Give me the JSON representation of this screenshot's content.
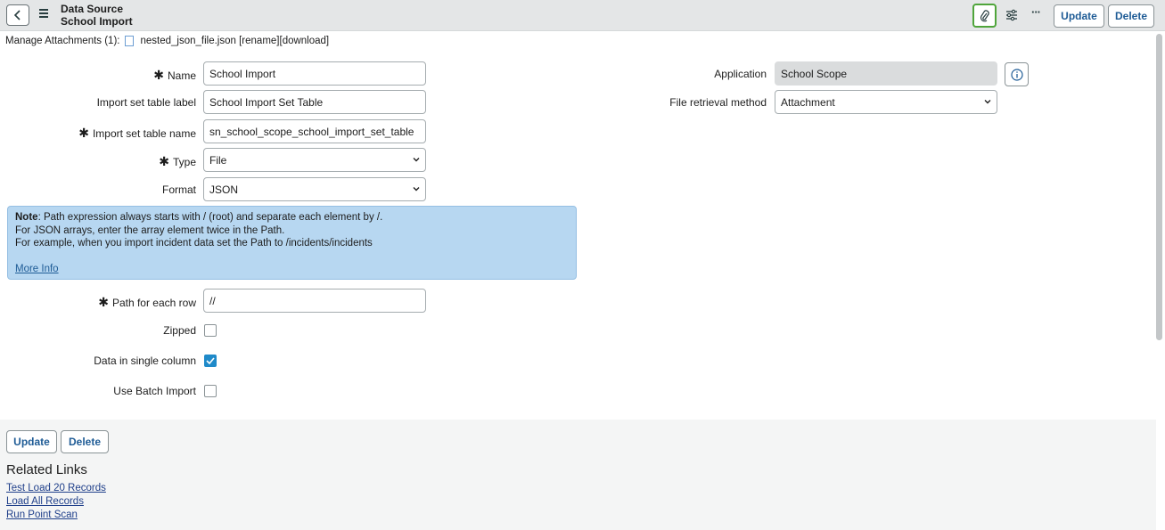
{
  "header": {
    "title_line1": "Data Source",
    "title_line2": "School Import",
    "more_label": "···",
    "update_label": "Update",
    "delete_label": "Delete"
  },
  "attachments": {
    "prefix": "Manage Attachments (1):",
    "file_name": "nested_json_file.json",
    "rename_label": "[rename]",
    "download_label": "[download]"
  },
  "form": {
    "name_label": "Name",
    "name_value": "School Import",
    "table_label_label": "Import set table label",
    "table_label_value": "School Import Set Table",
    "table_name_label": "Import set table name",
    "table_name_value": "sn_school_scope_school_import_set_table",
    "type_label": "Type",
    "type_value": "File",
    "format_label": "Format",
    "format_value": "JSON",
    "application_label": "Application",
    "application_value": "School Scope",
    "retrieval_label": "File retrieval method",
    "retrieval_value": "Attachment",
    "path_label": "Path for each row",
    "path_value": "//",
    "zipped_label": "Zipped",
    "zipped_checked": false,
    "single_column_label": "Data in single column",
    "single_column_checked": true,
    "batch_label": "Use Batch Import",
    "batch_checked": false
  },
  "note": {
    "bold": "Note",
    "line1": ": Path expression always starts with / (root) and separate each element by /.",
    "line2": "For JSON arrays, enter the array element twice in the Path.",
    "line3": "For example, when you import incident data set the Path to /incidents/incidents",
    "more_info": "More Info"
  },
  "footer": {
    "update_label": "Update",
    "delete_label": "Delete",
    "related_title": "Related Links",
    "links": [
      "Test Load 20 Records",
      "Load All Records",
      "Run Point Scan"
    ]
  },
  "colors": {
    "accent": "#1f5c96",
    "note_bg": "#b7d7f1",
    "checked": "#1f8ac9",
    "attach_border": "#4fa53b"
  }
}
